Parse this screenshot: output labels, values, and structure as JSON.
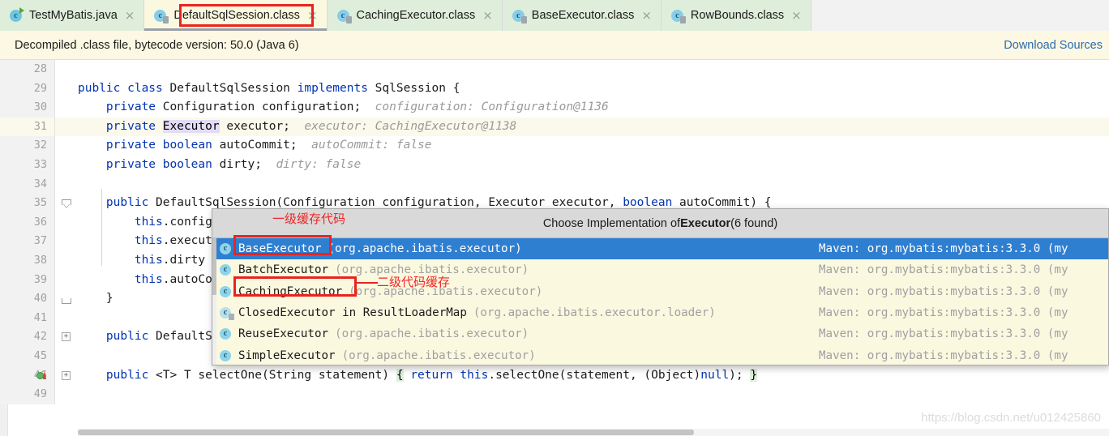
{
  "tabs": [
    {
      "label": "TestMyBatis.java",
      "icon": "java-class-icon",
      "state": "green",
      "close": "×"
    },
    {
      "label": "DefaultSqlSession.class",
      "icon": "class-file-icon",
      "state": "active",
      "close": "×"
    },
    {
      "label": "CachingExecutor.class",
      "icon": "class-file-icon",
      "state": "green",
      "close": "×"
    },
    {
      "label": "BaseExecutor.class",
      "icon": "class-file-icon",
      "state": "green",
      "close": "×"
    },
    {
      "label": "RowBounds.class",
      "icon": "class-file-icon",
      "state": "green",
      "close": "×"
    }
  ],
  "banner": {
    "message": "Decompiled .class file, bytecode version: 50.0 (Java 6)",
    "link": "Download Sources"
  },
  "editor": {
    "lines": [
      {
        "num": "28",
        "text": ""
      },
      {
        "num": "29",
        "text": "public class DefaultSqlSession implements SqlSession {"
      },
      {
        "num": "30",
        "text": "    private Configuration configuration;",
        "hint": "configuration: Configuration@1136"
      },
      {
        "num": "31",
        "text": "    private Executor executor;",
        "hint": "executor: CachingExecutor@1138",
        "highlighted": true
      },
      {
        "num": "32",
        "text": "    private boolean autoCommit;",
        "hint": "autoCommit: false"
      },
      {
        "num": "33",
        "text": "    private boolean dirty;",
        "hint": "dirty: false"
      },
      {
        "num": "34",
        "text": ""
      },
      {
        "num": "35",
        "text": "    public DefaultSqlSession(Configuration configuration, Executor executor, boolean autoCommit) {"
      },
      {
        "num": "36",
        "text": "        this.configuration = configuration;"
      },
      {
        "num": "37",
        "text": "        this.executor = executor;"
      },
      {
        "num": "38",
        "text": "        this.dirty = false;"
      },
      {
        "num": "39",
        "text": "        this.autoCommit = autoCommit;"
      },
      {
        "num": "40",
        "text": "    }"
      },
      {
        "num": "41",
        "text": ""
      },
      {
        "num": "42",
        "text": "    public DefaultSqlSession(Configuration configuration, Executor executor) { this(configuration, executor, autoCommit: false);"
      },
      {
        "num": "45",
        "text": ""
      },
      {
        "num": "46",
        "text": "    public <T> T selectOne(String statement) { return this.selectOne(statement, (Object)null); }"
      },
      {
        "num": "49",
        "text": ""
      }
    ]
  },
  "popup": {
    "title_prefix": "Choose Implementation of ",
    "title_bold": "Executor",
    "title_suffix": " (6 found)",
    "maven_label": "Maven: org.mybatis:mybatis:3.3.0 (my",
    "items": [
      {
        "cls": "BaseExecutor",
        "pkg": "(org.apache.ibatis.executor)",
        "icon": "class-icon",
        "selected": true
      },
      {
        "cls": "BatchExecutor",
        "pkg": "(org.apache.ibatis.executor)",
        "icon": "class-icon",
        "selected": false
      },
      {
        "cls": "CachingExecutor",
        "pkg": "(org.apache.ibatis.executor)",
        "icon": "class-icon",
        "selected": false
      },
      {
        "cls": "ClosedExecutor in ResultLoaderMap",
        "pkg": "(org.apache.ibatis.executor.loader)",
        "icon": "class-icon-abstract",
        "selected": false
      },
      {
        "cls": "ReuseExecutor",
        "pkg": "(org.apache.ibatis.executor)",
        "icon": "class-icon",
        "selected": false
      },
      {
        "cls": "SimpleExecutor",
        "pkg": "(org.apache.ibatis.executor)",
        "icon": "class-icon",
        "selected": false
      }
    ]
  },
  "annotations": {
    "first_cache": "一级缓存代码",
    "second_cache": "二级代码缓存"
  },
  "watermark": "https://blog.csdn.net/u012425860"
}
